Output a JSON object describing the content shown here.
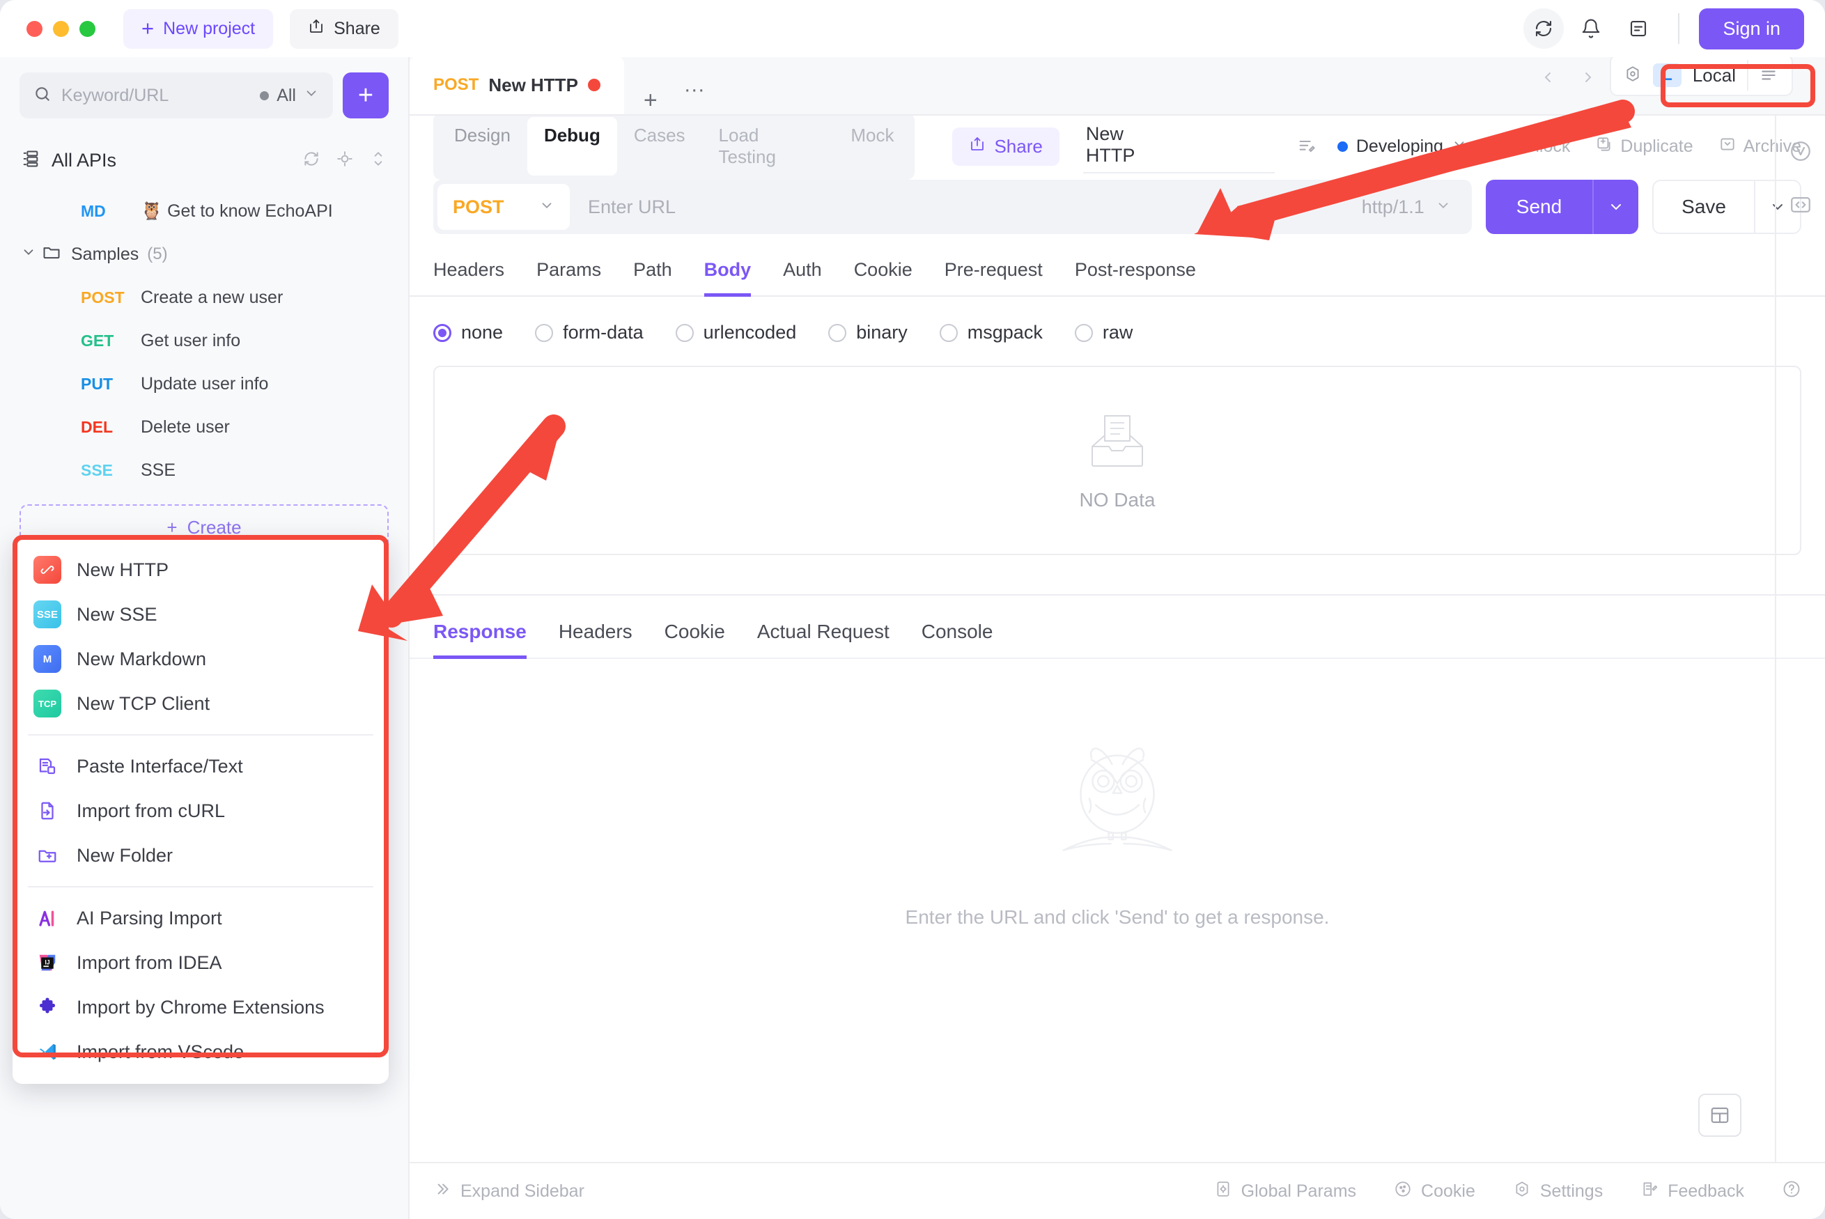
{
  "titlebar": {
    "new_project": "New project",
    "share": "Share",
    "sign_in": "Sign in",
    "icons": [
      "sync-icon",
      "bell-icon",
      "notes-icon"
    ]
  },
  "sidebar": {
    "search": {
      "placeholder": "Keyword/URL",
      "filter_label": "All"
    },
    "add_button_label": "+",
    "all_apis": {
      "label": "All APIs",
      "icons": [
        "refresh-icon",
        "locate-icon",
        "sort-icon"
      ]
    },
    "tree": [
      {
        "method": "MD",
        "method_class": "m-md",
        "label": "🦉 Get to know EchoAPI",
        "indent": true
      },
      {
        "method": "",
        "method_class": "",
        "label": "Samples",
        "count": "(5)",
        "folder": true
      },
      {
        "method": "POST",
        "method_class": "m-post",
        "label": "Create a new user",
        "indent": true
      },
      {
        "method": "GET",
        "method_class": "m-get",
        "label": "Get user info",
        "indent": true
      },
      {
        "method": "PUT",
        "method_class": "m-put",
        "label": "Update user info",
        "indent": true
      },
      {
        "method": "DEL",
        "method_class": "m-del",
        "label": "Delete user",
        "indent": true
      },
      {
        "method": "SSE",
        "method_class": "m-sse",
        "label": "SSE",
        "indent": true
      }
    ],
    "create_label": "Create"
  },
  "context_menu": {
    "groups": [
      [
        {
          "icon": "http-tile-icon",
          "tile": "http",
          "tile_text": "",
          "label": "New HTTP"
        },
        {
          "icon": "sse-tile-icon",
          "tile": "sse",
          "tile_text": "SSE",
          "label": "New SSE"
        },
        {
          "icon": "markdown-tile-icon",
          "tile": "md",
          "tile_text": "M",
          "label": "New Markdown"
        },
        {
          "icon": "tcp-tile-icon",
          "tile": "tcp",
          "tile_text": "TCP",
          "label": "New TCP Client"
        }
      ],
      [
        {
          "icon": "paste-interface-icon",
          "label": "Paste Interface/Text"
        },
        {
          "icon": "import-curl-icon",
          "label": "Import from cURL"
        },
        {
          "icon": "new-folder-icon",
          "label": "New Folder"
        }
      ],
      [
        {
          "icon": "ai-parsing-icon",
          "label": "AI Parsing Import"
        },
        {
          "icon": "intellij-idea-icon",
          "label": "Import from IDEA"
        },
        {
          "icon": "chrome-extension-icon",
          "label": "Import by Chrome Extensions"
        },
        {
          "icon": "vscode-icon",
          "label": "Import from VScode"
        }
      ]
    ]
  },
  "main": {
    "doc_tab": {
      "method": "POST",
      "title": "New HTTP"
    },
    "environment": {
      "chip": "L",
      "name": "Local"
    },
    "view_tabs": [
      {
        "label": "Design",
        "state": "normal"
      },
      {
        "label": "Debug",
        "state": "active"
      },
      {
        "label": "Cases",
        "state": "dim"
      },
      {
        "label": "Load Testing",
        "state": "dim"
      },
      {
        "label": "Mock",
        "state": "dim"
      }
    ],
    "share_label": "Share",
    "request_title": "New HTTP",
    "status_label": "Developing",
    "header_actions": [
      {
        "label": "Unlock",
        "icon": "unlock-icon"
      },
      {
        "label": "Duplicate",
        "icon": "duplicate-icon"
      },
      {
        "label": "Archive",
        "icon": "archive-icon"
      }
    ],
    "url_row": {
      "method": "POST",
      "url_placeholder": "Enter URL",
      "http_version": "http/1.1",
      "send_label": "Send",
      "save_label": "Save"
    },
    "request_tabs": [
      {
        "label": "Headers",
        "active": false
      },
      {
        "label": "Params",
        "active": false
      },
      {
        "label": "Path",
        "active": false
      },
      {
        "label": "Body",
        "active": true
      },
      {
        "label": "Auth",
        "active": false
      },
      {
        "label": "Cookie",
        "active": false
      },
      {
        "label": "Pre-request",
        "active": false
      },
      {
        "label": "Post-response",
        "active": false
      }
    ],
    "body_types": [
      {
        "label": "none",
        "selected": true
      },
      {
        "label": "form-data",
        "selected": false
      },
      {
        "label": "urlencoded",
        "selected": false
      },
      {
        "label": "binary",
        "selected": false
      },
      {
        "label": "msgpack",
        "selected": false
      },
      {
        "label": "raw",
        "selected": false
      }
    ],
    "no_data_label": "NO Data",
    "response_tabs": [
      {
        "label": "Response",
        "active": true
      },
      {
        "label": "Headers",
        "active": false
      },
      {
        "label": "Cookie",
        "active": false
      },
      {
        "label": "Actual Request",
        "active": false
      },
      {
        "label": "Console",
        "active": false
      }
    ],
    "empty_response_hint": "Enter the URL and click 'Send' to get a response."
  },
  "statusbar": {
    "expand_sidebar": "Expand Sidebar",
    "items": [
      {
        "label": "Global Params",
        "icon": "global-params-icon"
      },
      {
        "label": "Cookie",
        "icon": "cookie-icon"
      },
      {
        "label": "Settings",
        "icon": "settings-icon"
      },
      {
        "label": "Feedback",
        "icon": "feedback-icon"
      }
    ],
    "help_icon": "help-icon"
  },
  "colors": {
    "accent": "#7b57f5",
    "annotation": "#f4483c",
    "method_post": "#f9a825",
    "method_get": "#24c08a",
    "method_put": "#168fe5",
    "method_del": "#f4361f",
    "method_sse": "#5ed2f0",
    "method_md": "#2196f3"
  }
}
